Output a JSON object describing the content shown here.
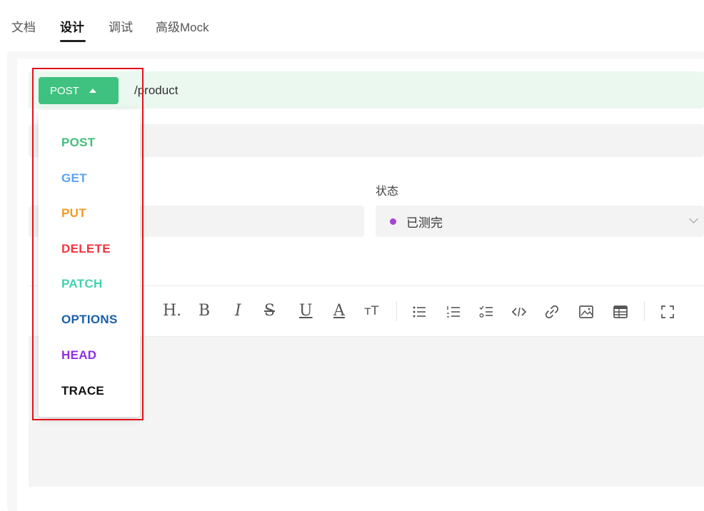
{
  "tabs": [
    {
      "label": "文档"
    },
    {
      "label": "设计"
    },
    {
      "label": "调试"
    },
    {
      "label": "高级Mock"
    }
  ],
  "active_tab": "设计",
  "request": {
    "method": "POST",
    "path": "/product"
  },
  "form": {
    "status_label": "状态",
    "status_value": "已测完",
    "status_color": "#a445d8"
  },
  "toolbar": {
    "heading": "H.",
    "bold": "B",
    "italic": "I",
    "strike": "S",
    "underline": "U",
    "font_color": "A",
    "font_size": "тT",
    "tools": [
      "unordered-list",
      "ordered-list",
      "task-list",
      "code",
      "link",
      "image",
      "table",
      "fullscreen"
    ]
  },
  "method_menu": [
    {
      "label": "POST",
      "color": "#3fbf7b"
    },
    {
      "label": "GET",
      "color": "#5aa3f2"
    },
    {
      "label": "PUT",
      "color": "#f59a23"
    },
    {
      "label": "DELETE",
      "color": "#f0353f"
    },
    {
      "label": "PATCH",
      "color": "#40d3b0"
    },
    {
      "label": "OPTIONS",
      "color": "#1a5fa8"
    },
    {
      "label": "HEAD",
      "color": "#8e2de2"
    },
    {
      "label": "TRACE",
      "color": "#111111"
    }
  ]
}
